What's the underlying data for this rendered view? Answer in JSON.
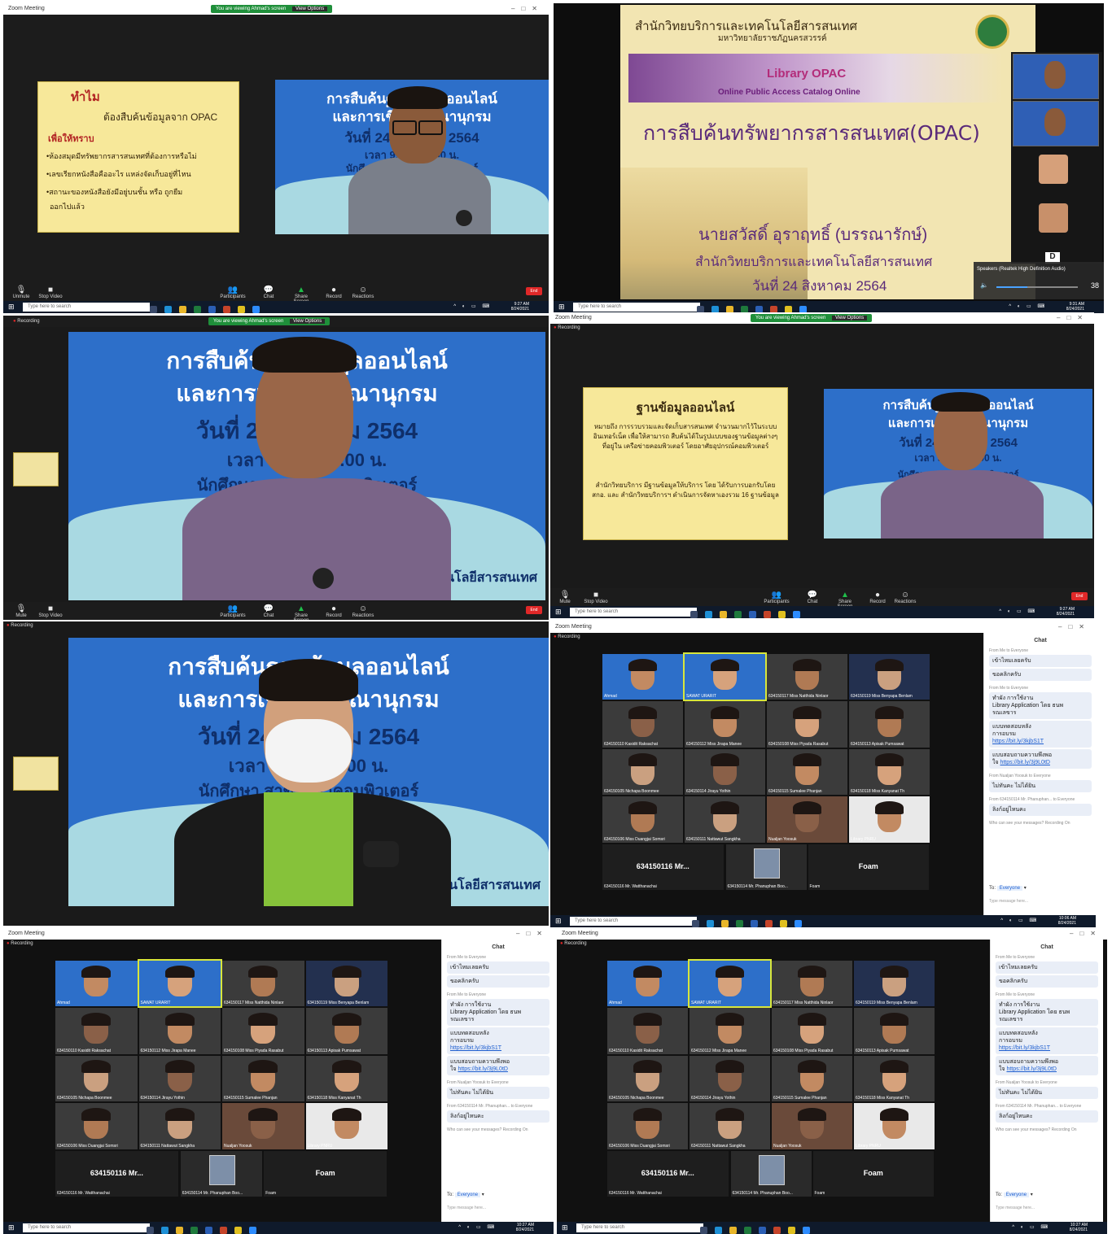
{
  "app": {
    "window_title": "Zoom Meeting",
    "recording": "Recording",
    "view": "View",
    "share_banner": "You are viewing Ahmad's screen",
    "view_options": "View Options",
    "taskbar_search": "Type here to search"
  },
  "toolbar": {
    "unmute": "Unmute",
    "mute": "Mute",
    "stop_video": "Stop Video",
    "participants": "Participants",
    "chat": "Chat",
    "share_screen": "Share Screen",
    "record": "Record",
    "reactions": "Reactions",
    "end": "End"
  },
  "clock": {
    "p1": "9:27 AM",
    "p2": "9:31 AM",
    "p3": "9:27 AM",
    "p4": "10:06 AM",
    "p5": "10:27 AM",
    "p6": "10:27 AM",
    "date": "8/24/2021"
  },
  "slide_why": {
    "q": "ทำไม",
    "title": "ต้องสืบค้นข้อมูลจาก OPAC",
    "sub": "เพื่อให้ทราบ",
    "b1": "•ห้องสมุดมีทรัพยากรสารสนเทศที่ต้องการหรือไม่",
    "b2": "•เลขเรียกหนังสือคืออะไร แหล่งจัดเก็บอยู่ที่ไหน",
    "b3": "•สถานะของหนังสือยังมีอยู่บนชั้น หรือ ถูกยืม",
    "b4": "ออกไปแล้ว"
  },
  "slide_title": {
    "line1": "การสืบค้นฐานข้อมูลออนไลน์",
    "line2": "และการเขียนบรรณานุกรม",
    "line3": "วันที่ 24 สิงหาคม 2564",
    "line4": "เวลา 9.00 - 12.00 น.",
    "line5": "นักศึกษา สาขาวิชาคอมพิวเตอร์",
    "footer": "สำนักวิทยบริการและเทคโนโลยีสารสนเทศ"
  },
  "slide_opac": {
    "org": "สำนักวิทยบริการและเทคโนโลยีสารสนเทศ",
    "univ": "มหาวิทยาลัยราชภัฏนครสวรรค์",
    "library": "Library",
    "opac": "OPAC",
    "opac_full": "Online Public Access Catalog Online",
    "title": "การสืบค้นทรัพยากรสารสนเทศ(OPAC)",
    "presenter": "นายสวัสดิ์ อุราฤทธิ์ (บรรณารักษ์)",
    "dept": "สำนักวิทยบริการและเทคโนโลยีสารสนเทศ",
    "date": "วันที่ 24 สิงหาคม 2564",
    "speakers": "Speakers (Realtek High Definition Audio)",
    "volume": "38"
  },
  "slide_db": {
    "title": "ฐานข้อมูลออนไลน์",
    "p1": "หมายถึง การรวบรวมและจัดเก็บสารสนเทศ จำนวนมากไว้ในระบบอินเทอร์เน็ต เพื่อให้สามารถ สืบค้นได้ในรูปแบบของฐานข้อมูลต่างๆ ที่อยู่ใน เครือข่ายคอมพิวเตอร์ โดยอาศัยอุปกรณ์คอมพิวเตอร์",
    "p2": "สำนักวิทยบริการ มีฐานข้อมูลให้บริการ โดย ได้รับการบอกรับโดย สกอ. และ สำนักวิทยบริการฯ ดำเนินการจัดหาเองรวม 16 ฐานข้อมูล"
  },
  "gallery": {
    "tiles": [
      "Ahmad",
      "SAWAT URARIT",
      "634150117 Miss Natthida Ninlaor",
      "634150119 Miss Benyapa Benlam",
      "634150110 Kasidit Raksachat",
      "634150112 Miss Jirapa Manee",
      "634150108 Miss Piyada Rasabut",
      "634150113 Apisak Pumsawat",
      "634150105 Nichapa Boonmee",
      "634150114 Jirayu Yothin",
      "634150115 Sumalee Phanjan",
      "634150118 Miss Kanyanat Th",
      "634150106 Miss Duangjai Somsri",
      "634150111 Nattawut Sangkha",
      "Nualjan Yoosuk",
      "Library PNRU"
    ],
    "name_only_1": "634150116 Mr...",
    "name_only_1_sub": "634150116 Mr. Watthanachai",
    "center_tile": "634150114 Mr. Phanuphan Boo...",
    "name_only_2": "Foam",
    "name_only_2_sub": "Foam"
  },
  "chat": {
    "header": "Chat",
    "from1": "From Me to Everyone",
    "m1": "เข้าไหมเลยครับ",
    "m2": "ขอคลิกครับ",
    "from2": "From Me to Everyone",
    "m3a": "ทำผัง การใช้งาน ",
    "m3b": "Library Application โดย ธนพ",
    "m3c": "รณเลขาร",
    "m4a": "แบบทดสอบหลัง",
    "m4b": "การอบรม",
    "m4c": "https://bit.ly/3kjbS1T",
    "m5a": "แบบสอบถามความพึงพอ",
    "m5b": "ใจ ",
    "m5c": "https://bit.ly/3j9L0tD",
    "from3": "From Nualjan Yoosuk to Everyone",
    "m6": "ไม่ทันคะ ไม่ได้ยิน",
    "from4": "From 634150114 Mr. Phanuphan... to Everyone",
    "m7": "ลิงก์อยู่ไหนคะ",
    "notice": "Who can see your messages? Recording On",
    "to_label": "To:",
    "to_value": "Everyone",
    "placeholder": "Type message here..."
  },
  "colors": {
    "zoom_bg": "#1c1c1c",
    "share_green": "#1f8f3a",
    "slide_blue": "#2d6fc9",
    "slide_yellow": "#f7e89a",
    "end_red": "#e02828",
    "active_speaker": "#d8e63b"
  }
}
